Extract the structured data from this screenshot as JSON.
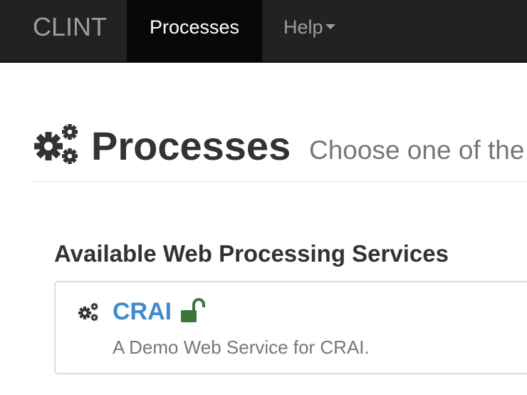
{
  "navbar": {
    "brand": "CLINT",
    "items": [
      {
        "label": "Processes",
        "active": true
      },
      {
        "label": "Help",
        "dropdown": true
      }
    ]
  },
  "header": {
    "icon": "cogs-icon",
    "title": "Processes",
    "subtitle": "Choose one of the"
  },
  "section": {
    "title": "Available Web Processing Services"
  },
  "services": [
    {
      "icon": "cogs-icon",
      "name": "CRAI",
      "lock_icon": "unlock-icon",
      "lock_color": "#3c763d",
      "description": "A Demo Web Service for CRAI."
    }
  ],
  "colors": {
    "navbar_bg": "#222222",
    "navbar_active_bg": "#080808",
    "link": "#428bca",
    "lock_green": "#3c763d"
  }
}
